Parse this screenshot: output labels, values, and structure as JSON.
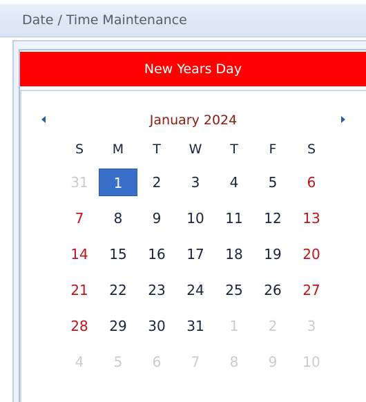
{
  "window": {
    "title": "Date / Time Maintenance"
  },
  "holiday": {
    "label": "New Years Day"
  },
  "calendar": {
    "month_label": "January 2024",
    "days_of_week": [
      "S",
      "M",
      "T",
      "W",
      "T",
      "F",
      "S"
    ],
    "weeks": [
      [
        {
          "d": "31",
          "t": "other"
        },
        {
          "d": "1",
          "t": "selected"
        },
        {
          "d": "2",
          "t": "normal"
        },
        {
          "d": "3",
          "t": "normal"
        },
        {
          "d": "4",
          "t": "normal"
        },
        {
          "d": "5",
          "t": "normal"
        },
        {
          "d": "6",
          "t": "weekend"
        }
      ],
      [
        {
          "d": "7",
          "t": "weekend"
        },
        {
          "d": "8",
          "t": "normal"
        },
        {
          "d": "9",
          "t": "normal"
        },
        {
          "d": "10",
          "t": "normal"
        },
        {
          "d": "11",
          "t": "normal"
        },
        {
          "d": "12",
          "t": "normal"
        },
        {
          "d": "13",
          "t": "weekend"
        }
      ],
      [
        {
          "d": "14",
          "t": "weekend"
        },
        {
          "d": "15",
          "t": "normal"
        },
        {
          "d": "16",
          "t": "normal"
        },
        {
          "d": "17",
          "t": "normal"
        },
        {
          "d": "18",
          "t": "normal"
        },
        {
          "d": "19",
          "t": "normal"
        },
        {
          "d": "20",
          "t": "weekend"
        }
      ],
      [
        {
          "d": "21",
          "t": "weekend"
        },
        {
          "d": "22",
          "t": "normal"
        },
        {
          "d": "23",
          "t": "normal"
        },
        {
          "d": "24",
          "t": "normal"
        },
        {
          "d": "25",
          "t": "normal"
        },
        {
          "d": "26",
          "t": "normal"
        },
        {
          "d": "27",
          "t": "weekend"
        }
      ],
      [
        {
          "d": "28",
          "t": "weekend"
        },
        {
          "d": "29",
          "t": "normal"
        },
        {
          "d": "30",
          "t": "normal"
        },
        {
          "d": "31",
          "t": "normal"
        },
        {
          "d": "1",
          "t": "other"
        },
        {
          "d": "2",
          "t": "other"
        },
        {
          "d": "3",
          "t": "other"
        }
      ],
      [
        {
          "d": "4",
          "t": "other"
        },
        {
          "d": "5",
          "t": "other"
        },
        {
          "d": "6",
          "t": "other"
        },
        {
          "d": "7",
          "t": "other"
        },
        {
          "d": "8",
          "t": "other"
        },
        {
          "d": "9",
          "t": "other"
        },
        {
          "d": "10",
          "t": "other"
        }
      ]
    ]
  },
  "icons": {
    "prev": "triangle-left-icon",
    "next": "triangle-right-icon"
  },
  "colors": {
    "holiday_bar": "#ff0000",
    "selected_day": "#3a6fc9",
    "weekend_text": "#c0141a",
    "month_text": "#8b1a10",
    "other_month_text": "#c8ccd2"
  }
}
